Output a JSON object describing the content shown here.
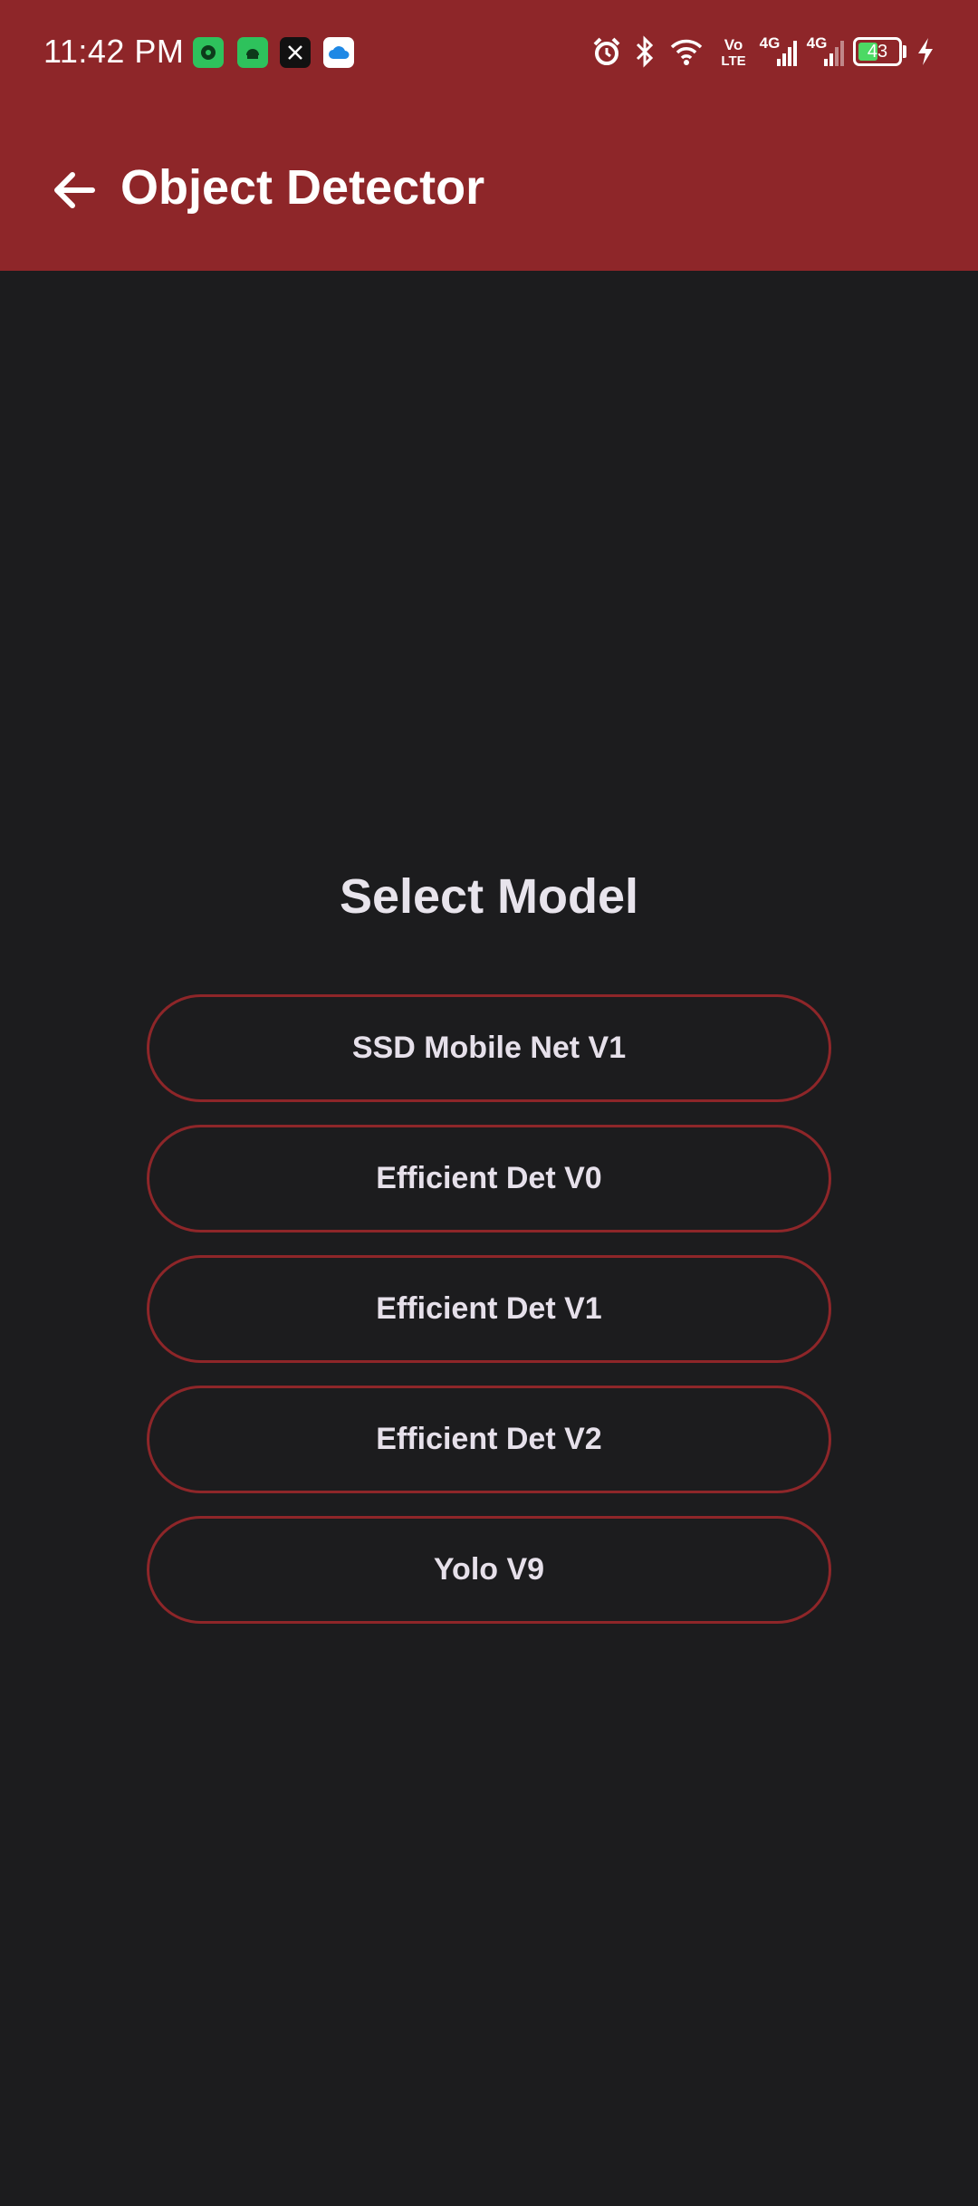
{
  "status_bar": {
    "time": "11:42 PM",
    "volte_top": "Vo",
    "volte_bottom": "LTE",
    "sim1_label": "4G",
    "sim2_label": "4G",
    "battery_level": "43",
    "notification_icons": [
      "game-app-icon",
      "android-app-icon",
      "x-app-icon",
      "cloud-app-icon"
    ]
  },
  "app_bar": {
    "title": "Object Detector",
    "background_color": "#8e2629"
  },
  "main": {
    "heading": "Select Model",
    "models": [
      {
        "label": "SSD Mobile Net V1"
      },
      {
        "label": "Efficient Det V0"
      },
      {
        "label": "Efficient Det V1"
      },
      {
        "label": "Efficient Det V2"
      },
      {
        "label": "Yolo V9"
      }
    ],
    "button_border_color": "#8e2629",
    "background_color": "#1c1c1e"
  }
}
